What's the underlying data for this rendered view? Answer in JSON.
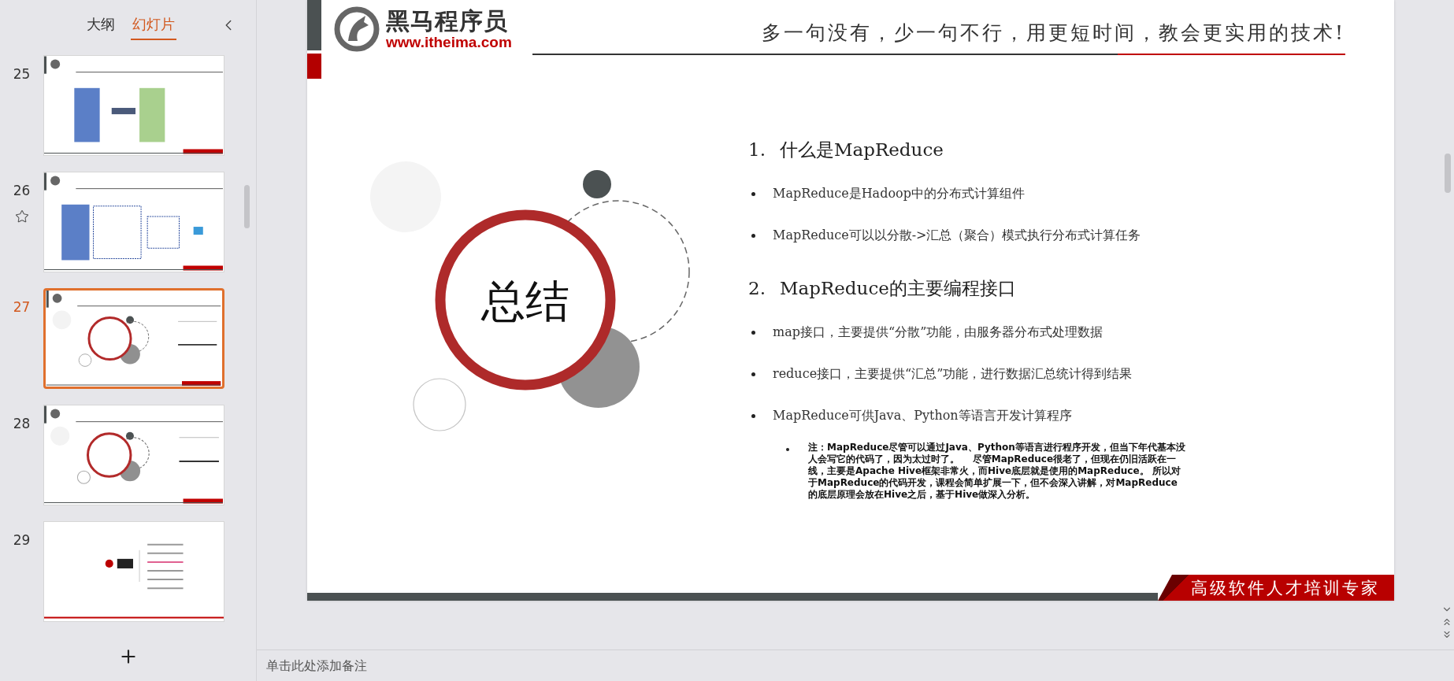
{
  "sidebar": {
    "tabs": [
      {
        "label": "大纲",
        "selected": false
      },
      {
        "label": "幻灯片",
        "selected": true
      }
    ],
    "slides": [
      {
        "number": "25",
        "selected": false,
        "starred": false,
        "kind": "table"
      },
      {
        "number": "26",
        "selected": false,
        "starred": true,
        "kind": "flow"
      },
      {
        "number": "27",
        "selected": true,
        "starred": false,
        "kind": "summary"
      },
      {
        "number": "28",
        "selected": false,
        "starred": false,
        "kind": "summary"
      },
      {
        "number": "29",
        "selected": false,
        "starred": false,
        "kind": "contents"
      }
    ]
  },
  "slide": {
    "logo": {
      "name": "黑马程序员",
      "url": "www.itheima.com"
    },
    "slogan": "多一句没有，少一句不行，用更短时间，教会更实用的技术!",
    "badge": "总结",
    "items": [
      {
        "kind": "heading",
        "number": "1.",
        "text": "什么是MapReduce"
      },
      {
        "kind": "bullet",
        "text": "MapReduce是Hadoop中的分布式计算组件"
      },
      {
        "kind": "bullet",
        "text": "MapReduce可以以分散->汇总（聚合）模式执行分布式计算任务"
      },
      {
        "kind": "heading",
        "number": "2.",
        "text": "MapReduce的主要编程接口"
      },
      {
        "kind": "bullet",
        "text": "map接口，主要提供“分散”功能，由服务器分布式处理数据"
      },
      {
        "kind": "bullet",
        "text": "reduce接口，主要提供“汇总”功能，进行数据汇总统计得到结果"
      },
      {
        "kind": "bullet",
        "text": "MapReduce可供Java、Python等语言开发计算程序"
      },
      {
        "kind": "note",
        "text": "注：MapReduce尽管可以通过Java、Python等语言进行程序开发，但当下年代基本没人会写它的代码了，因为太过时了。    尽管MapReduce很老了，但现在仍旧活跃在一线，主要是Apache Hive框架非常火，而Hive底层就是使用的MapReduce。 所以对于MapReduce的代码开发，课程会简单扩展一下，但不会深入讲解，对MapReduce的底层原理会放在Hive之后，基于Hive做深入分析。"
      }
    ],
    "footer": "高级软件人才培训专家"
  },
  "notes": {
    "placeholder": "单击此处添加备注"
  }
}
